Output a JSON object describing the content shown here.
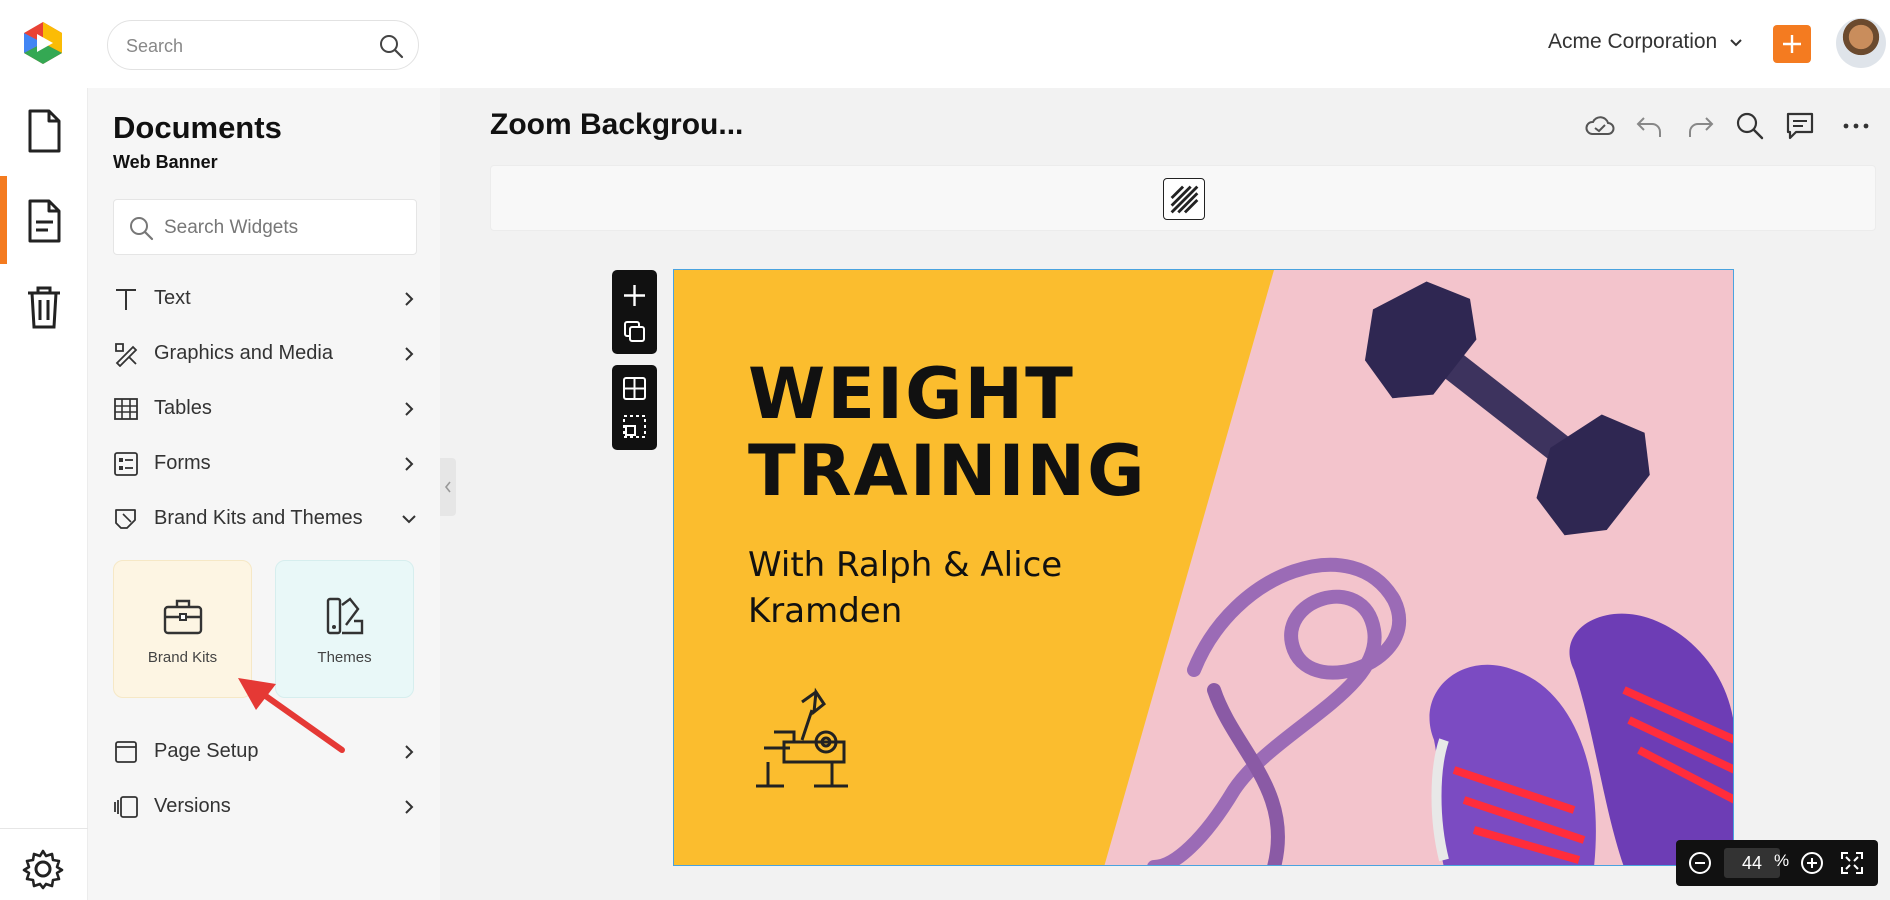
{
  "topbar": {
    "search_placeholder": "Search",
    "org_name": "Acme Corporation"
  },
  "panel": {
    "title": "Documents",
    "subtitle": "Web Banner",
    "widget_search_placeholder": "Search Widgets",
    "menu": [
      {
        "label": "Text",
        "icon": "text-icon"
      },
      {
        "label": "Graphics and Media",
        "icon": "graphics-icon"
      },
      {
        "label": "Tables",
        "icon": "table-icon"
      },
      {
        "label": "Forms",
        "icon": "forms-icon"
      },
      {
        "label": "Brand Kits and Themes",
        "icon": "brand-icon",
        "expanded": true
      },
      {
        "label": "Page Setup",
        "icon": "page-setup-icon"
      },
      {
        "label": "Versions",
        "icon": "versions-icon"
      }
    ],
    "tiles": [
      {
        "label": "Brand Kits",
        "bg": "#fdf5e3",
        "icon": "briefcase-icon"
      },
      {
        "label": "Themes",
        "bg": "#e9f8f8",
        "icon": "themes-icon"
      }
    ]
  },
  "editor": {
    "doc_title": "Zoom Backgrou...",
    "zoom_value": "44",
    "zoom_unit": "%"
  },
  "banner": {
    "headline_line1": "WEIGHT",
    "headline_line2": "TRAINING",
    "byline_line1": "With Ralph & Alice",
    "byline_line2": "Kramden",
    "yellow": "#fbbd2e",
    "pink": "#f3c4cc"
  },
  "colors": {
    "accent": "#f47b20",
    "selection": "#4aa3df"
  }
}
